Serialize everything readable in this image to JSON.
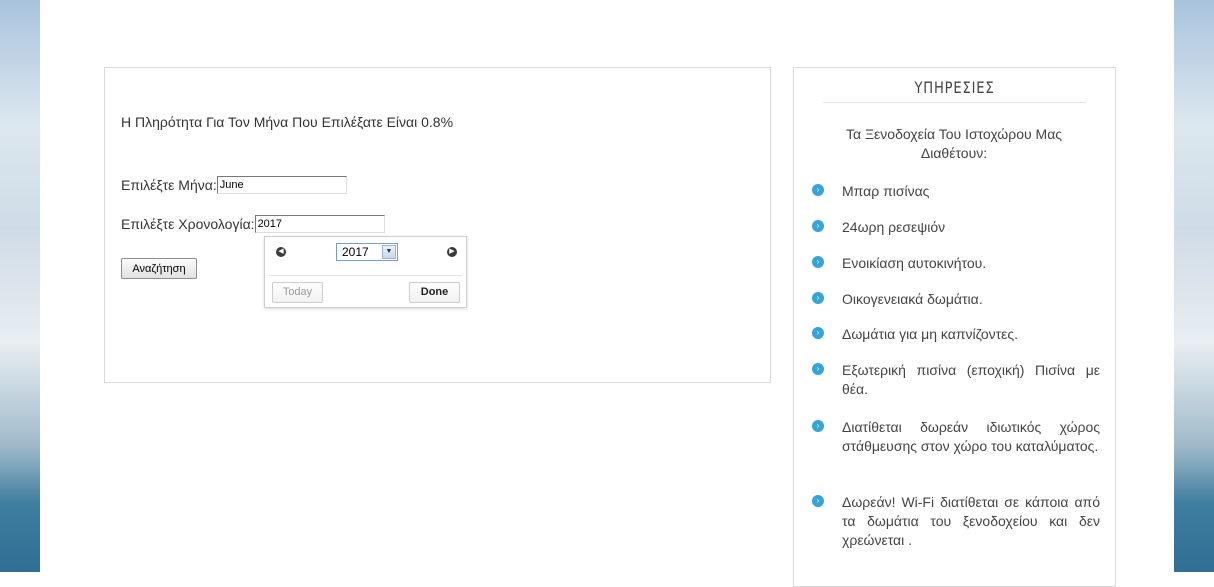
{
  "main": {
    "fill_rate_text": "Η Πληρότητα Για Τον Μήνα Που Επιλέξατε Είναι 0.8%",
    "month_label": "Επιλέξτε Μήνα:",
    "month_value": "June",
    "year_label": "Επιλέξτε Χρονολογία:",
    "year_value": "2017",
    "search_button": "Αναζήτηση"
  },
  "datepicker": {
    "prev_icon": "prev-arrow-icon",
    "next_icon": "next-arrow-icon",
    "selected_year": "2017",
    "today_button": "Today",
    "done_button": "Done"
  },
  "services": {
    "title": "ΥΠΗΡΕΣΙΕΣ",
    "intro": "Τα Ξενοδοχεία Του Ιστοχώρου Μας Διαθέτουν:",
    "items": [
      "Μπαρ πισίνας",
      "24ωρη ρεσεψιόν",
      "Ενοικίαση αυτοκινήτου.",
      "Οικογενειακά δωμάτια.",
      "Δωμάτια για μη καπνίζοντες.",
      "Εξωτερική πισίνα (εποχική) Πισίνα με θέα.",
      "Διατίθεται δωρεάν ιδιωτικός χώρος στάθμευσης στον χώρο του καταλύματος.",
      "Δωρεάν! Wi-Fi διατίθεται σε κάποια από τα δωμάτια του ξενοδοχείου και δεν χρεώνεται ."
    ]
  },
  "colors": {
    "accent_bullet": "#36a3d9",
    "panel_border": "#d9d9d9"
  }
}
